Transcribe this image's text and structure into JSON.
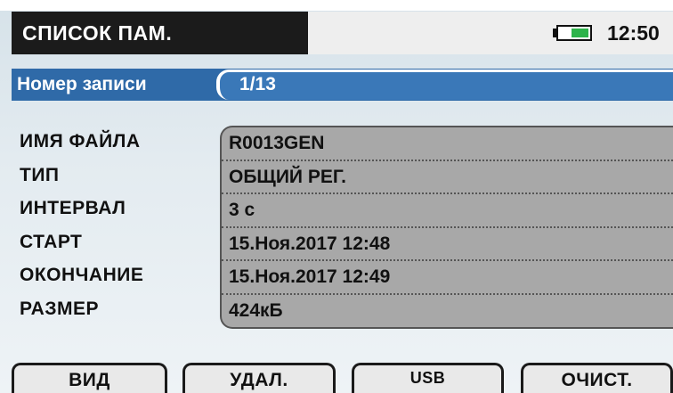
{
  "header": {
    "title": "СПИСОК ПАМ.",
    "time": "12:50",
    "battery_level": 0.6,
    "battery_color": "#2db34a"
  },
  "record": {
    "label": "Номер записи",
    "value": "1/13"
  },
  "info": {
    "labels": [
      "ИМЯ ФАЙЛА",
      "ТИП",
      "ИНТЕРВАЛ",
      "СТАРТ",
      "ОКОНЧАНИЕ",
      "РАЗМЕР"
    ],
    "values": [
      "R0013GEN",
      "ОБЩИЙ РЕГ.",
      "3 с",
      "15.Ноя.2017 12:48",
      "15.Ноя.2017 12:49",
      "424кБ"
    ]
  },
  "buttons": {
    "view": "ВИД",
    "delete": "УДАЛ.",
    "usb": "USB",
    "clear": "ОЧИСТ."
  },
  "colors": {
    "header_bg": "#1b1b1b",
    "record_bar": "#2f6aa8",
    "value_panel": "#a8a8a8"
  }
}
